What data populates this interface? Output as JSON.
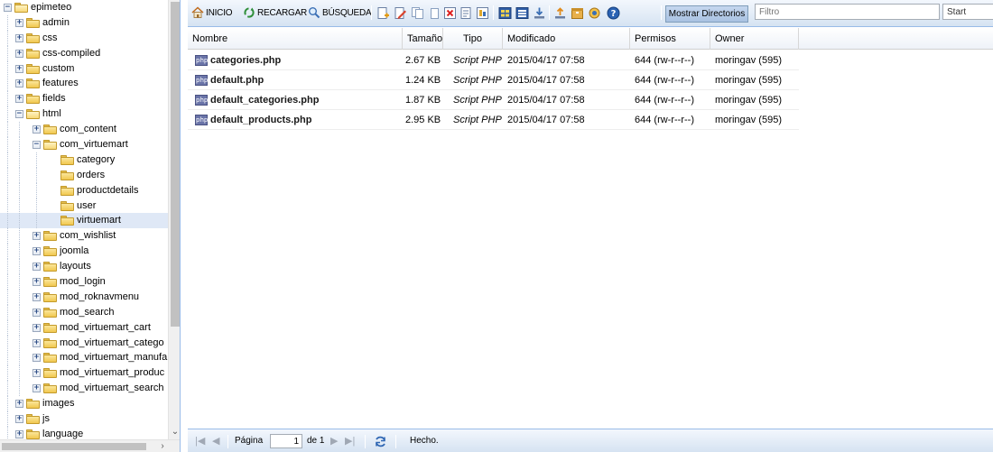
{
  "tree": {
    "items": [
      {
        "label": "epimeteo",
        "state": "open",
        "level": 0
      },
      {
        "label": "admin",
        "state": "collapsed",
        "level": 1
      },
      {
        "label": "css",
        "state": "collapsed",
        "level": 1
      },
      {
        "label": "css-compiled",
        "state": "collapsed",
        "level": 1
      },
      {
        "label": "custom",
        "state": "collapsed",
        "level": 1
      },
      {
        "label": "features",
        "state": "collapsed",
        "level": 1
      },
      {
        "label": "fields",
        "state": "collapsed",
        "level": 1
      },
      {
        "label": "html",
        "state": "open",
        "level": 1
      },
      {
        "label": "com_content",
        "state": "collapsed",
        "level": 2
      },
      {
        "label": "com_virtuemart",
        "state": "open",
        "level": 2
      },
      {
        "label": "category",
        "state": "leaf",
        "level": 3
      },
      {
        "label": "orders",
        "state": "leaf",
        "level": 3
      },
      {
        "label": "productdetails",
        "state": "leaf",
        "level": 3
      },
      {
        "label": "user",
        "state": "leaf",
        "level": 3
      },
      {
        "label": "virtuemart",
        "state": "leaf",
        "level": 3,
        "selected": true
      },
      {
        "label": "com_wishlist",
        "state": "collapsed",
        "level": 2
      },
      {
        "label": "joomla",
        "state": "collapsed",
        "level": 2
      },
      {
        "label": "layouts",
        "state": "collapsed",
        "level": 2
      },
      {
        "label": "mod_login",
        "state": "collapsed",
        "level": 2
      },
      {
        "label": "mod_roknavmenu",
        "state": "collapsed",
        "level": 2
      },
      {
        "label": "mod_search",
        "state": "collapsed",
        "level": 2
      },
      {
        "label": "mod_virtuemart_cart",
        "state": "collapsed",
        "level": 2
      },
      {
        "label": "mod_virtuemart_catego",
        "state": "collapsed",
        "level": 2
      },
      {
        "label": "mod_virtuemart_manufa",
        "state": "collapsed",
        "level": 2
      },
      {
        "label": "mod_virtuemart_produc",
        "state": "collapsed",
        "level": 2
      },
      {
        "label": "mod_virtuemart_search",
        "state": "collapsed",
        "level": 2
      },
      {
        "label": "images",
        "state": "collapsed",
        "level": 1
      },
      {
        "label": "js",
        "state": "collapsed",
        "level": 1
      },
      {
        "label": "language",
        "state": "collapsed",
        "level": 1
      }
    ]
  },
  "toolbar": {
    "inicio_label": "INICIO",
    "recargar_label": "RECARGAR",
    "busqueda_label": "BÚSQUEDA",
    "mostrar_directorios_label": "Mostrar Directorios",
    "filter_placeholder": "Filtro",
    "start_value": "Start"
  },
  "grid": {
    "columns": {
      "nombre": "Nombre",
      "tamano": "Tamaño",
      "tipo": "Tipo",
      "modificado": "Modificado",
      "permisos": "Permisos",
      "owner": "Owner"
    },
    "file_icon_text": "php",
    "rows": [
      {
        "nombre": "categories.php",
        "tamano": "2.67 KB",
        "tipo": "Script PHP",
        "modificado": "2015/04/17 07:58",
        "permisos": "644 (rw-r--r--)",
        "owner": "moringav (595)"
      },
      {
        "nombre": "default.php",
        "tamano": "1.24 KB",
        "tipo": "Script PHP",
        "modificado": "2015/04/17 07:58",
        "permisos": "644 (rw-r--r--)",
        "owner": "moringav (595)"
      },
      {
        "nombre": "default_categories.php",
        "tamano": "1.87 KB",
        "tipo": "Script PHP",
        "modificado": "2015/04/17 07:58",
        "permisos": "644 (rw-r--r--)",
        "owner": "moringav (595)"
      },
      {
        "nombre": "default_products.php",
        "tamano": "2.95 KB",
        "tipo": "Script PHP",
        "modificado": "2015/04/17 07:58",
        "permisos": "644 (rw-r--r--)",
        "owner": "moringav (595)"
      }
    ]
  },
  "paging": {
    "page_label": "Página",
    "page_value": "1",
    "of_label": "de 1",
    "status_text": "Hecho."
  }
}
